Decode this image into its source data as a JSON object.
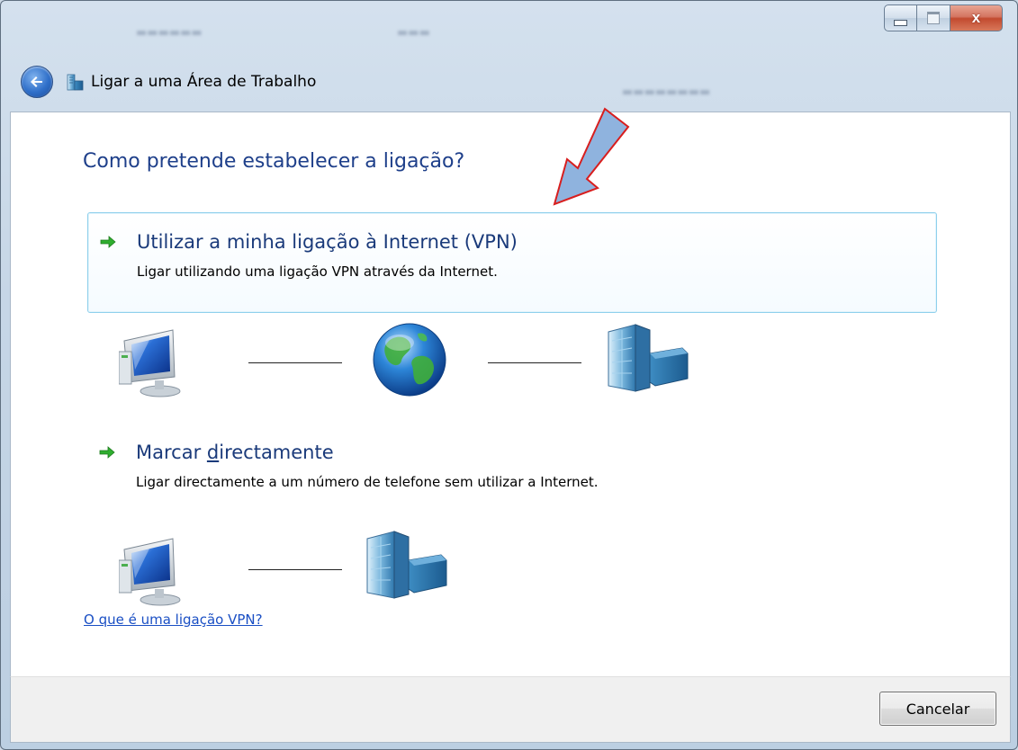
{
  "window": {
    "title": "Ligar a uma Área de Trabalho",
    "close_glyph": "x",
    "controls": [
      "minimize-icon",
      "maximize-icon",
      "close-icon"
    ]
  },
  "nav": {
    "back_icon": "back-arrow-icon",
    "wizard_icon": "network-wizard-icon"
  },
  "main": {
    "question": "Como pretende estabelecer a ligação?",
    "options": [
      {
        "title": "Utilizar a minha ligação à Internet (VPN)",
        "description": "Ligar utilizando uma ligação VPN através da Internet.",
        "icon": "green-arrow-icon",
        "diagram": [
          "computer-icon",
          "globe-icon",
          "office-building-icon"
        ]
      },
      {
        "title_prefix": "Marcar ",
        "title_accel": "d",
        "title_suffix": "irectamente",
        "description": "Ligar directamente a um número de telefone sem utilizar a Internet.",
        "icon": "green-arrow-icon",
        "diagram": [
          "computer-icon",
          "office-building-icon"
        ]
      }
    ],
    "help_link": "O que é uma ligação VPN?"
  },
  "footer": {
    "cancel_label": "Cancelar"
  },
  "colors": {
    "heading": "#1e3f8a",
    "link": "#1a4fc4",
    "selected_border": "#8fd0ec",
    "annotation_arrow_fill": "#8fb3de",
    "annotation_arrow_stroke": "#d81e1e"
  }
}
